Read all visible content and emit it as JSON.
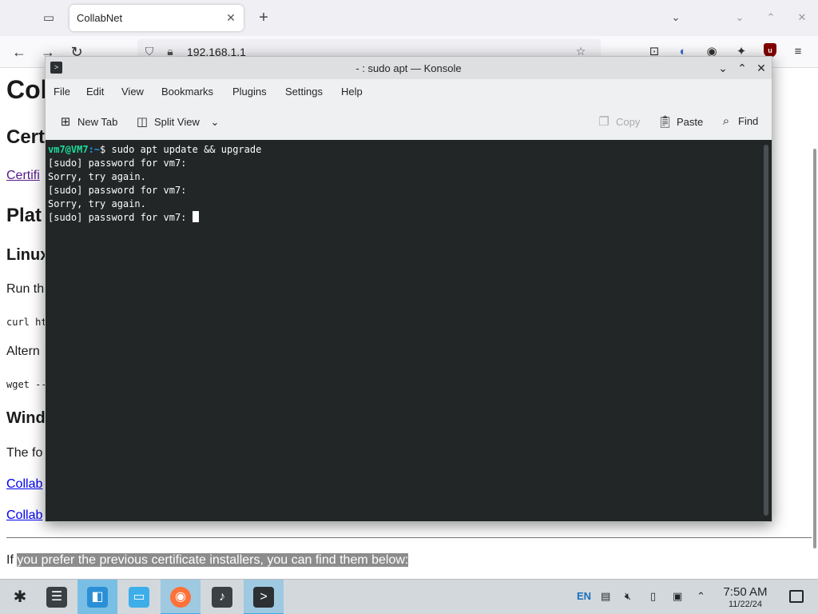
{
  "browser": {
    "tab_title": "CollabNet",
    "url": "192.168.1.1",
    "page": {
      "h1": "Coll",
      "h2_cert": "Cert",
      "cert_link": "Certifi",
      "h2_plat": "Plat",
      "h3_linux": "Linux",
      "run_text": "Run th",
      "curl_code": "curl ht",
      "alt_text": "Altern",
      "wget_code": "wget --",
      "h3_windows": "Wind",
      "following_text": "The fo",
      "collab_link_1": "Collab",
      "collab_link_2": "Collab",
      "footer_prefix": "If ",
      "footer_selected": "you prefer the previous certificate installers, you can find them below:"
    }
  },
  "konsole": {
    "title": "- : sudo apt — Konsole",
    "menu": [
      "File",
      "Edit",
      "View",
      "Bookmarks",
      "Plugins",
      "Settings",
      "Help"
    ],
    "toolbar": {
      "new_tab": "New Tab",
      "split_view": "Split View",
      "copy": "Copy",
      "paste": "Paste",
      "find": "Find"
    },
    "terminal": {
      "prompt_user": "vm7@VM7",
      "prompt_path": ":~",
      "command": "$ sudo apt update && upgrade",
      "lines": [
        "[sudo] password for vm7:",
        "Sorry, try again.",
        "[sudo] password for vm7:",
        "Sorry, try again.",
        "[sudo] password for vm7: "
      ]
    }
  },
  "taskbar": {
    "language": "EN",
    "time": "7:50 AM",
    "date": "11/22/24"
  },
  "colors": {
    "terminal_bg": "#232627",
    "prompt_user": "#1cdc9a",
    "prompt_path": "#1d99f3",
    "accent": "#3daee9"
  }
}
